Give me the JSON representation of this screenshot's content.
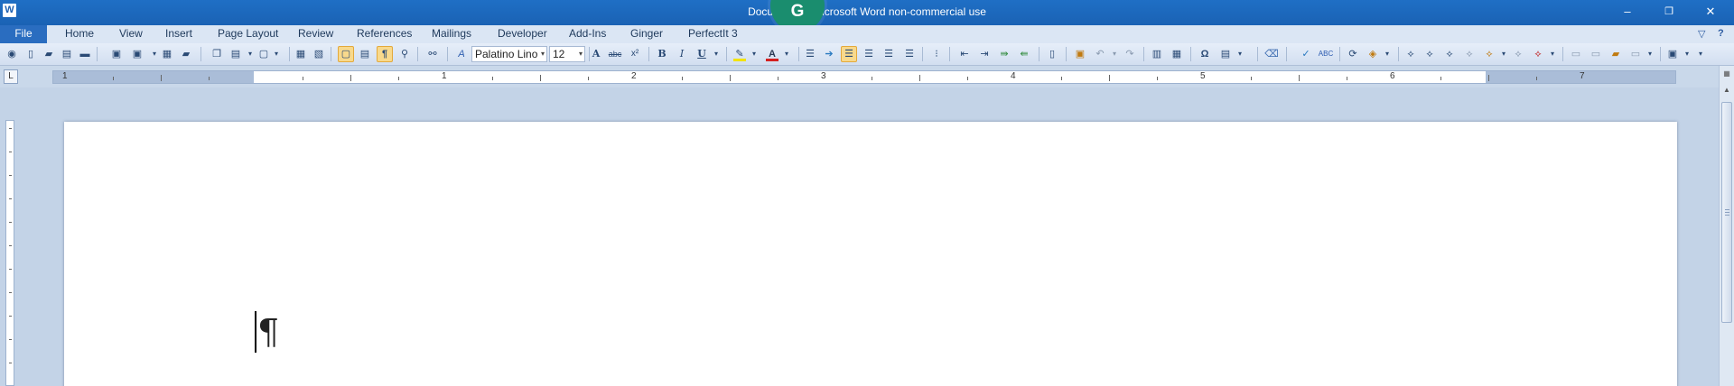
{
  "window": {
    "title": "Document1 - Microsoft Word non-commercial use",
    "app_icon": "W",
    "grammarly_badge": "G",
    "controls": {
      "minimize": "–",
      "restore": "❐",
      "close": "✕"
    }
  },
  "menu": {
    "tabs": [
      "File",
      "Home",
      "View",
      "Insert",
      "Page Layout",
      "Review",
      "References",
      "Mailings",
      "Developer",
      "Add-Ins",
      "Ginger",
      "PerfectIt 3"
    ],
    "help_icons": [
      "▽",
      "?"
    ]
  },
  "toolbar": {
    "font_name": "Palatino Lino",
    "font_size": "12",
    "bold": "B",
    "italic": "I",
    "underline": "U",
    "strikethrough": "abc",
    "superscript": "x²",
    "font_color_letter": "A",
    "font_color": "#d42020",
    "highlight_color": "#f2e300",
    "symbol": "Ω",
    "show_marks": "¶"
  },
  "ruler": {
    "corner_label": "L",
    "numbers": [
      "1",
      "1",
      "2",
      "3",
      "4",
      "5",
      "6",
      "7"
    ]
  },
  "document": {
    "paragraph_mark": "¶"
  }
}
